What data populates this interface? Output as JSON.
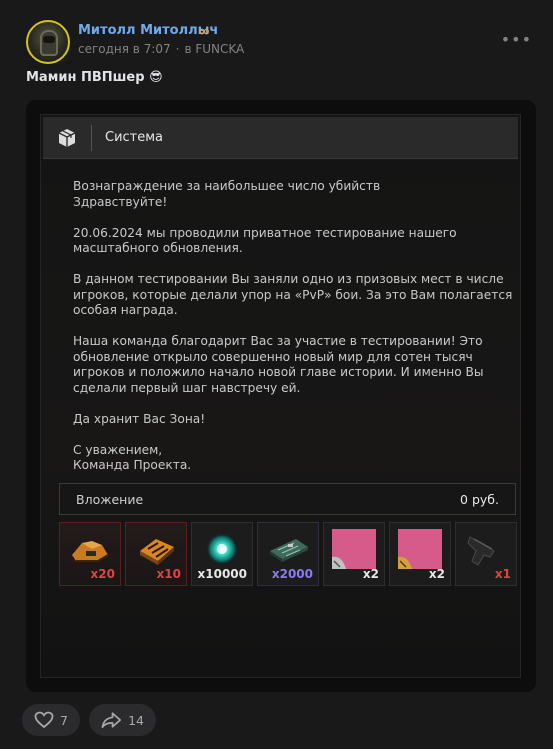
{
  "post": {
    "author_name": "Митолл Митоллыч",
    "author_badge_icon": "infinity-icon",
    "time": "сегодня в 7:07",
    "separator": "·",
    "group": "в FUNCKA",
    "text": "Мамин ПВПшер",
    "text_emoji": "😎",
    "menu_icon": "more-dots-icon"
  },
  "window": {
    "title": "Система",
    "icon": "box-icon"
  },
  "message": {
    "line1": "Вознаграждение за наибольшее число убийств",
    "line2": "Здравствуйте!",
    "p2": "20.06.2024 мы проводили приватное тестирование нашего масштабного обновления.",
    "p3": "В данном тестировании Вы заняли одно из призовых мест в числе игроков, которые делали упор на «PvP» бои. За это Вам полагается особая награда.",
    "p4": "Наша команда благодарит Вас за участие в тестировании! Это обновление открыло совершенно новый мир для сотен тысяч игроков и положило начало новой главе истории. И именно Вы сделали первый шаг навстречу ей.",
    "p5": "Да хранит Вас Зона!",
    "p6_line1": "С уважением,",
    "p6_line2": "Команда Проекта."
  },
  "attachment": {
    "label": "Вложение",
    "amount": "0 руб."
  },
  "items": [
    {
      "icon": "armor-plate-icon",
      "count": "x20",
      "color": "#e04343"
    },
    {
      "icon": "ammo-case-icon",
      "count": "x10",
      "color": "#e04343"
    },
    {
      "icon": "energy-orb-icon",
      "count": "x10000",
      "color": "#e8e8e8"
    },
    {
      "icon": "circuit-board-icon",
      "count": "x2000",
      "color": "#8a7cf0"
    },
    {
      "icon": "pink-card-icon",
      "count": "x2",
      "color": "#e8e8e8"
    },
    {
      "icon": "pink-card-icon",
      "count": "x2",
      "color": "#e8e8e8"
    },
    {
      "icon": "pistol-icon",
      "count": "x1",
      "color": "#e04343"
    }
  ],
  "reactions": {
    "likes": "7",
    "shares": "14"
  }
}
